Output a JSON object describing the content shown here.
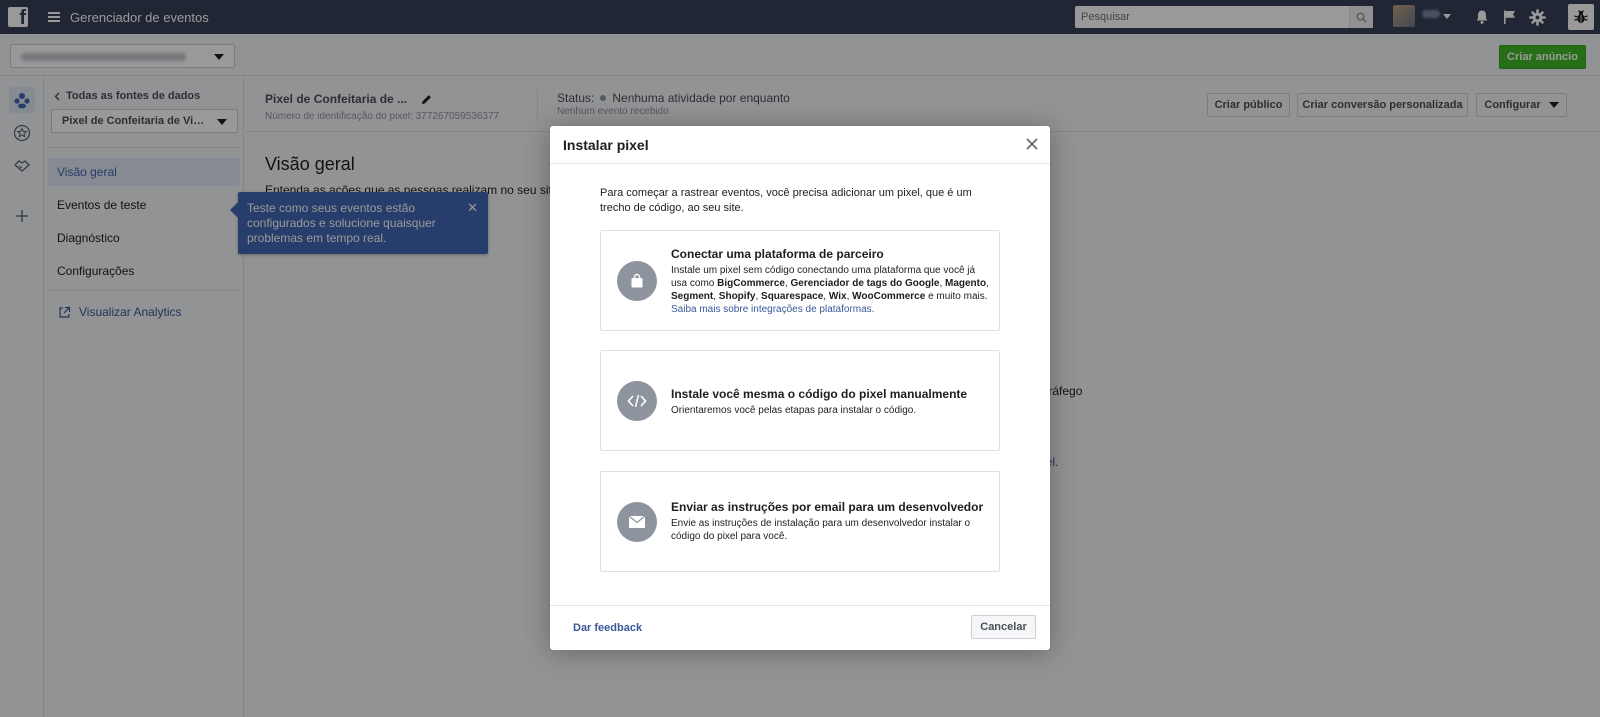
{
  "topbar": {
    "app_title": "Gerenciador de eventos",
    "search_placeholder": "Pesquisar",
    "icons": [
      "facebook-logo-icon",
      "menu-icon",
      "search-icon",
      "bell-icon",
      "flag-icon",
      "gear-icon",
      "bug-icon"
    ]
  },
  "subbar": {
    "create_ad_label": "Criar anúncio"
  },
  "sidebar": {
    "back_label": "Todas as fontes de dados",
    "pixel_select": "Pixel de Confeitaria de Victoria",
    "items": [
      {
        "label": "Visão geral",
        "active": true
      },
      {
        "label": "Eventos de teste",
        "active": false
      },
      {
        "label": "Diagnóstico",
        "active": false
      },
      {
        "label": "Configurações",
        "active": false
      }
    ],
    "analytics_label": "Visualizar Analytics"
  },
  "tooltip": {
    "text": "Teste como seus eventos estão configurados e solucione quaisquer problemas em tempo real."
  },
  "pixel_header": {
    "name": "Pixel de Confeitaria de ...",
    "id_text": "Número de identificação do pixel: 377267059536377",
    "status_label": "Status:",
    "status_value": "Nenhuma atividade por enquanto",
    "status_sub": "Nenhum evento recebido",
    "buttons": {
      "create_audience": "Criar público",
      "create_conversion": "Criar conversão personalizada",
      "configure": "Configurar"
    }
  },
  "main": {
    "title": "Visão geral",
    "description": "Entenda as ações que as pessoas realizam no seu site",
    "frag_traffic": "o tráfego",
    "frag_pixel": "ixel."
  },
  "modal": {
    "title": "Instalar pixel",
    "intro": "Para começar a rastrear eventos, você precisa adicionar um pixel, que é um trecho de código, ao seu site.",
    "options": [
      {
        "icon": "shopping-bag-icon",
        "title": "Conectar uma plataforma de parceiro",
        "desc_prefix": "Instale um pixel sem código conectando uma plataforma que você já usa como ",
        "platforms": [
          "BigCommerce",
          "Gerenciador de tags do Google",
          "Magento",
          "Segment",
          "Shopify",
          "Squarespace",
          "Wix",
          "WooCommerce"
        ],
        "desc_suffix": " e muito mais. ",
        "link": "Saiba mais sobre integrações de plataformas."
      },
      {
        "icon": "code-icon",
        "title": "Instale você mesma o código do pixel manualmente",
        "desc": "Orientaremos você pelas etapas para instalar o código."
      },
      {
        "icon": "envelope-icon",
        "title": "Enviar as instruções por email para um desenvolvedor",
        "desc": "Envie as instruções de instalação para um desenvolvedor instalar o código do pixel para você."
      }
    ],
    "feedback_label": "Dar feedback",
    "cancel_label": "Cancelar"
  }
}
